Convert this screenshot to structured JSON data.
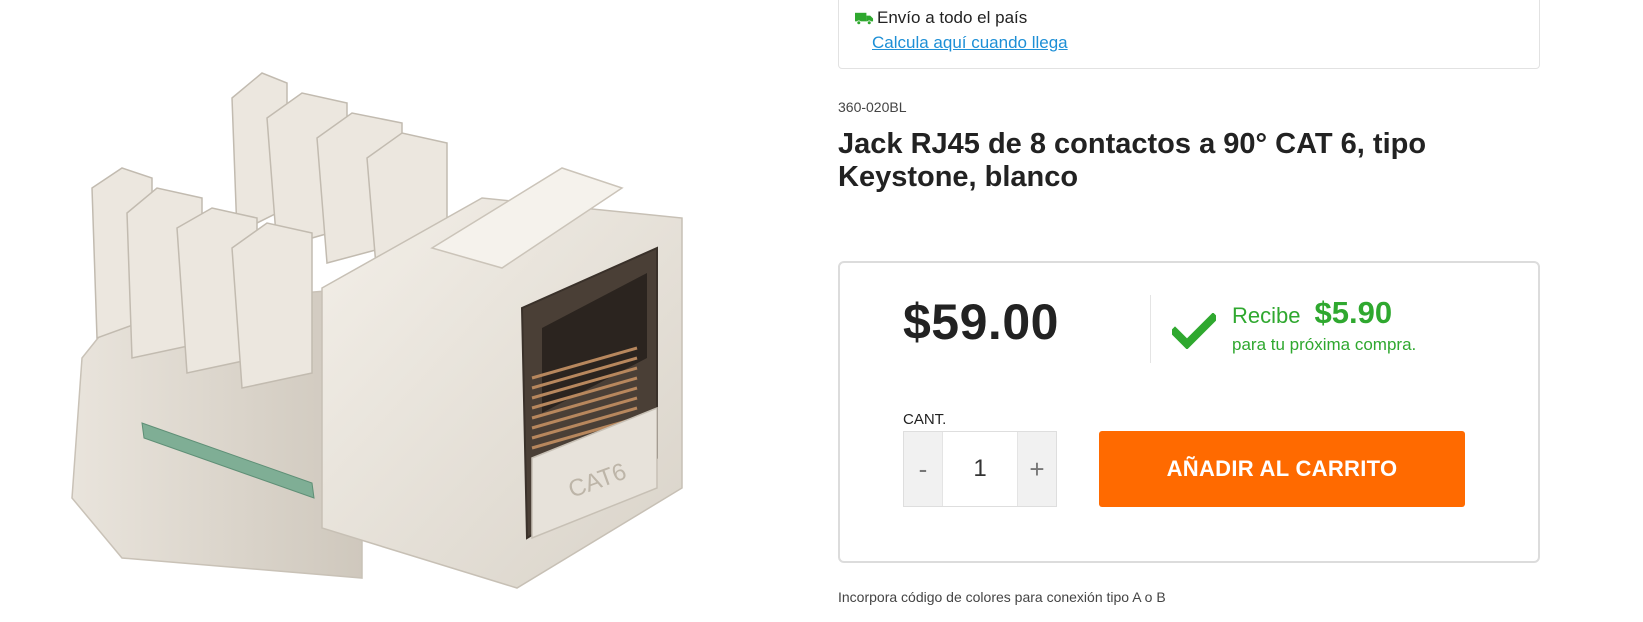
{
  "shipping": {
    "icon": "truck-icon",
    "text": "Envío a todo el país",
    "link": "Calcula aquí cuando llega"
  },
  "product": {
    "sku": "360-020BL",
    "title": "Jack RJ45 de 8 contactos a 90° CAT 6, tipo Keystone, blanco",
    "image_icon": "product-photo",
    "image_marking": "CAT6",
    "description": "Incorpora código de colores para conexión tipo A o B"
  },
  "purchase": {
    "price": "$59.00",
    "reward_icon": "check-icon",
    "reward_label": "Recibe",
    "reward_amount": "$5.90",
    "reward_sub": "para tu próxima compra.",
    "qty_label": "CANT.",
    "qty_minus": "-",
    "qty_value": "1",
    "qty_plus": "+",
    "add_to_cart": "AÑADIR AL CARRITO"
  },
  "colors": {
    "accent": "#ff6a00",
    "reward_green": "#2fa82f",
    "link_blue": "#1d8fd6"
  }
}
